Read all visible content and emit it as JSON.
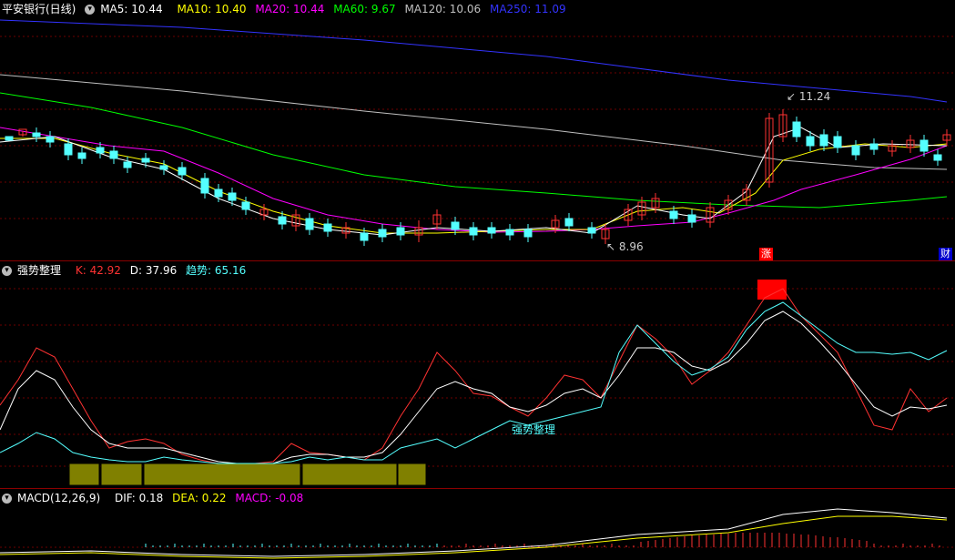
{
  "price_pane": {
    "stock_name": "平安银行(日线)",
    "ma5": "MA5: 10.44",
    "ma10": "MA10: 10.40",
    "ma20": "MA20: 10.44",
    "ma60": "MA60: 9.67",
    "ma120": "MA120: 10.06",
    "ma250": "MA250: 11.09",
    "high_label": "11.24",
    "low_label": "8.96",
    "event_limit_up": "涨",
    "event_finance": "财",
    "colors": {
      "ma5": "#ffffff",
      "ma10": "#ffff00",
      "ma20": "#ff00ff",
      "ma60": "#00ff00",
      "ma120": "#c0c0c0",
      "ma250": "#3333ff",
      "up": "#ff3232",
      "down": "#54ffff"
    }
  },
  "kd_pane": {
    "indicator_name": "强势整理",
    "k_label": "K: 42.92",
    "d_label": "D: 37.96",
    "trend_label": "趋势: 65.16",
    "chart_annotation": "强势整理",
    "colors": {
      "k": "#ff3232",
      "d": "#ffffff",
      "trend": "#54ffff",
      "band": "#808000",
      "signal": "#ff0000"
    }
  },
  "macd_pane": {
    "indicator_name": "MACD(12,26,9)",
    "dif_label": "DIF: 0.18",
    "dea_label": "DEA: 0.22",
    "macd_label": "MACD: -0.08",
    "colors": {
      "dif": "#ffffff",
      "dea": "#ffff00",
      "macd": "#ff00ff"
    }
  }
}
